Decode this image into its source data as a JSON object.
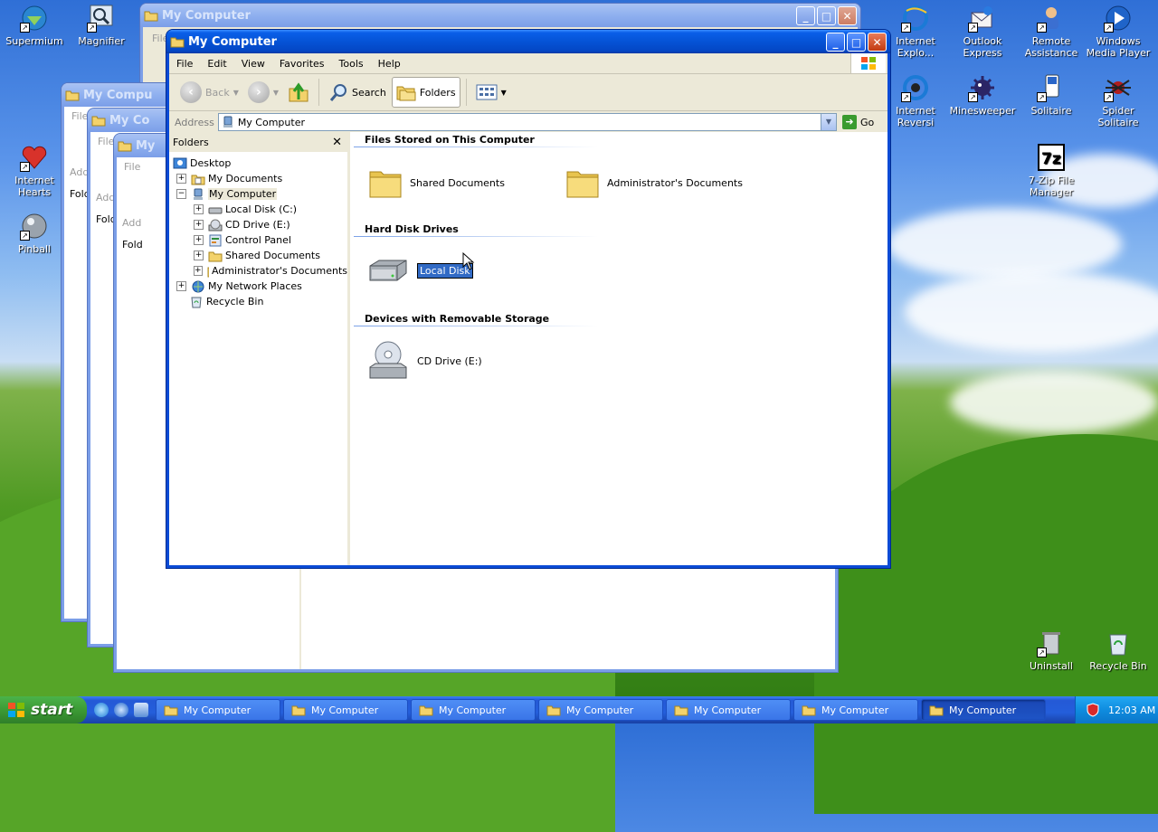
{
  "desktop": {
    "icons_left": [
      {
        "label": "Supermium"
      },
      {
        "label": "Magnifier"
      },
      {
        "label": "Internet Hearts"
      },
      {
        "label": "Pinball"
      }
    ],
    "icons_right": [
      {
        "label": "Internet Explo..."
      },
      {
        "label": "Outlook Express"
      },
      {
        "label": "Remote Assistance"
      },
      {
        "label": "Windows Media Player"
      },
      {
        "label": "Internet Reversi"
      },
      {
        "label": "Minesweeper"
      },
      {
        "label": "Solitaire"
      },
      {
        "label": "Spider Solitaire"
      },
      {
        "label": "7-Zip File Manager"
      },
      {
        "label": "Uninstall"
      },
      {
        "label": "Recycle Bin"
      }
    ]
  },
  "background_windows": [
    {
      "title": "My Computer"
    },
    {
      "title": "My Compu"
    },
    {
      "title": "My Co"
    },
    {
      "title": "My"
    }
  ],
  "background_fragments": {
    "file": "File",
    "addr": "Add",
    "fold": "Fold"
  },
  "window": {
    "title": "My Computer",
    "menu": [
      "File",
      "Edit",
      "View",
      "Favorites",
      "Tools",
      "Help"
    ],
    "toolbar": {
      "back": "Back",
      "search": "Search",
      "folders": "Folders"
    },
    "address": {
      "label": "Address",
      "value": "My Computer",
      "go": "Go"
    },
    "folders_pane": {
      "title": "Folders",
      "tree": [
        {
          "label": "Desktop",
          "level": 0,
          "toggle": ""
        },
        {
          "label": "My Documents",
          "level": 1,
          "toggle": "+"
        },
        {
          "label": "My Computer",
          "level": 1,
          "toggle": "−",
          "selected": true
        },
        {
          "label": "Local Disk (C:)",
          "level": 2,
          "toggle": "+"
        },
        {
          "label": "CD Drive (E:)",
          "level": 2,
          "toggle": "+"
        },
        {
          "label": "Control Panel",
          "level": 2,
          "toggle": "+"
        },
        {
          "label": "Shared Documents",
          "level": 2,
          "toggle": "+"
        },
        {
          "label": "Administrator's Documents",
          "level": 2,
          "toggle": "+"
        },
        {
          "label": "My Network Places",
          "level": 1,
          "toggle": "+"
        },
        {
          "label": "Recycle Bin",
          "level": 1,
          "toggle": ""
        }
      ]
    },
    "groups": {
      "files_stored": "Files Stored on This Computer",
      "hard_disks": "Hard Disk Drives",
      "removable": "Devices with Removable Storage"
    },
    "items": {
      "shared_docs": "Shared Documents",
      "admin_docs": "Administrator's Documents",
      "local_disk_rename": "Local Disk",
      "cd_drive": "CD Drive (E:)"
    }
  },
  "taskbar": {
    "start": "start",
    "tasks": [
      "My Computer",
      "My Computer",
      "My Computer",
      "My Computer",
      "My Computer",
      "My Computer",
      "My Computer"
    ],
    "clock": "12:03 AM"
  },
  "colors": {
    "xp_blue": "#0b4bd6",
    "selection": "#316ac5"
  }
}
